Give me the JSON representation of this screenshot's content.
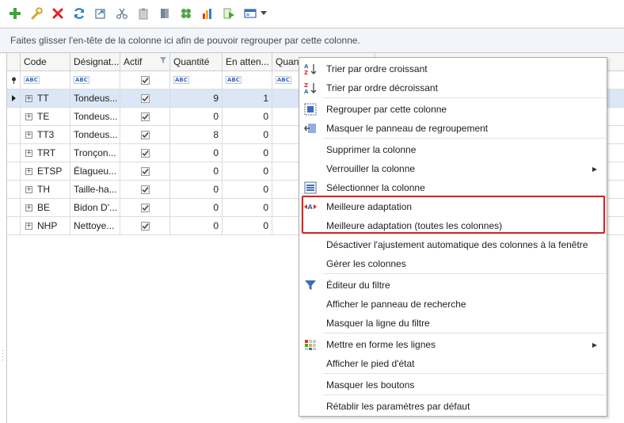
{
  "toolbar": {
    "buttons": [
      {
        "icon": "add-icon"
      },
      {
        "icon": "wrench-icon"
      },
      {
        "icon": "delete-icon"
      },
      {
        "icon": "refresh-icon"
      },
      {
        "icon": "export-icon"
      },
      {
        "icon": "cut-icon"
      },
      {
        "icon": "paste-icon"
      },
      {
        "icon": "document-icon"
      },
      {
        "icon": "puzzle-icon"
      },
      {
        "icon": "chart-icon"
      },
      {
        "icon": "run-icon"
      },
      {
        "icon": "window-icon"
      }
    ]
  },
  "grid": {
    "group_panel_text": "Faites glisser l'en-tête de la colonne ici afin de pouvoir regrouper par cette colonne.",
    "columns": [
      "Code",
      "Désignat...",
      "Actif",
      "Quantité",
      "En atten...",
      "Quanti"
    ],
    "filter_placeholder": "ABC",
    "rows": [
      {
        "code": "TT",
        "designation": "Tondeus...",
        "actif": true,
        "quantite": "9",
        "attente": "1"
      },
      {
        "code": "TE",
        "designation": "Tondeus...",
        "actif": true,
        "quantite": "0",
        "attente": "0"
      },
      {
        "code": "TT3",
        "designation": "Tondeus...",
        "actif": true,
        "quantite": "8",
        "attente": "0"
      },
      {
        "code": "TRT",
        "designation": "Tronçon...",
        "actif": true,
        "quantite": "0",
        "attente": "0"
      },
      {
        "code": "ETSP",
        "designation": "Élagueu...",
        "actif": true,
        "quantite": "0",
        "attente": "0"
      },
      {
        "code": "TH",
        "designation": "Taille-ha...",
        "actif": true,
        "quantite": "0",
        "attente": "0"
      },
      {
        "code": "BE",
        "designation": "Bidon D'...",
        "actif": true,
        "quantite": "0",
        "attente": "0"
      },
      {
        "code": "NHP",
        "designation": "Nettoye...",
        "actif": true,
        "quantite": "0",
        "attente": "0"
      }
    ]
  },
  "context_menu": {
    "items": [
      {
        "label": "Trier par ordre croissant",
        "icon": "sort-ascending-icon"
      },
      {
        "label": "Trier par ordre décroissant",
        "icon": "sort-descending-icon"
      },
      {
        "label": "Regrouper par cette colonne",
        "icon": "group-by-icon"
      },
      {
        "label": "Masquer le panneau de regroupement",
        "icon": "hide-group-panel-icon"
      },
      {
        "label": "Supprimer la colonne",
        "icon": ""
      },
      {
        "label": "Verrouiller la colonne",
        "icon": "",
        "submenu": true
      },
      {
        "label": "Sélectionner la colonne",
        "icon": "select-column-icon"
      },
      {
        "label": "Meilleure adaptation",
        "icon": "best-fit-icon"
      },
      {
        "label": "Meilleure adaptation (toutes les colonnes)",
        "icon": ""
      },
      {
        "label": "Désactiver l'ajustement automatique des colonnes à la fenêtre",
        "icon": ""
      },
      {
        "label": "Gérer les colonnes",
        "icon": ""
      },
      {
        "label": "Éditeur du filtre",
        "icon": "filter-icon"
      },
      {
        "label": "Afficher le panneau de recherche",
        "icon": ""
      },
      {
        "label": "Masquer la ligne du filtre",
        "icon": ""
      },
      {
        "label": "Mettre en forme les lignes",
        "icon": "format-rows-icon",
        "submenu": true
      },
      {
        "label": "Afficher le pied d'état",
        "icon": ""
      },
      {
        "label": "Masquer les boutons",
        "icon": ""
      },
      {
        "label": "Rétablir les paramètres par défaut",
        "icon": ""
      }
    ]
  },
  "colors": {
    "selected_row": "#dbe7f6",
    "highlight_border": "#d52424",
    "group_panel_bg": "#f2f6fb"
  }
}
